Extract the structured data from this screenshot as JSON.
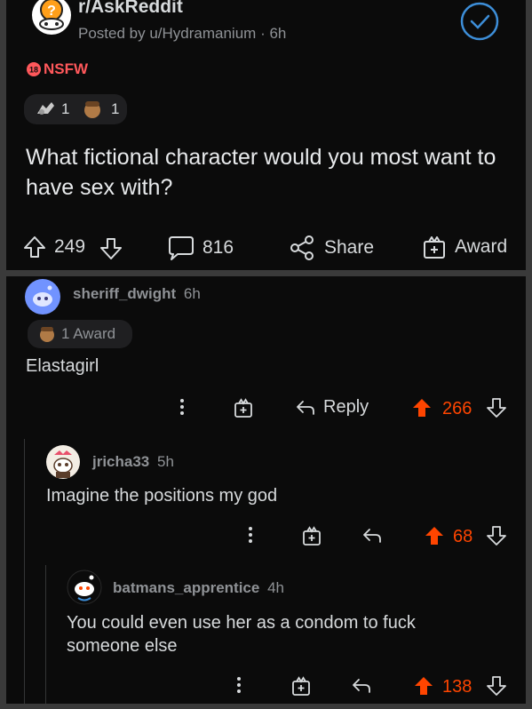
{
  "post": {
    "subreddit": "r/AskReddit",
    "posted_by": "Posted by u/Hydramanium",
    "age": "6h",
    "nsfw_badge": "NSFW",
    "award_count_1": "1",
    "award_count_2": "1",
    "title": "What fictional character would you most want to have sex with?",
    "upvotes": "249",
    "comments": "816",
    "share_label": "Share",
    "award_label": "Award"
  },
  "comments": [
    {
      "username": "sheriff_dwight",
      "age": "6h",
      "award_label": "1 Award",
      "body": "Elastagirl",
      "reply_label": "Reply",
      "score": "266"
    },
    {
      "username": "jricha33",
      "age": "5h",
      "body": "Imagine the positions my god",
      "score": "68"
    },
    {
      "username": "batmans_apprentice",
      "age": "4h",
      "body_line1": "You could even use her as a condom to fuck",
      "body_line2": "someone else",
      "score": "138"
    }
  ],
  "colors": {
    "background": "#0b0b0b",
    "separator": "#3a3a3a",
    "upvote_accent": "#ff4500",
    "nsfw": "#ff585b",
    "check": "#3d8ed8"
  }
}
